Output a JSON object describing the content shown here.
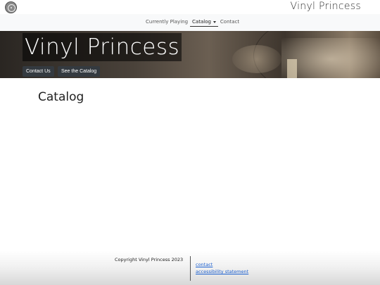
{
  "topbar": {
    "logo_icon": "vinyl-record-icon",
    "brand": "Vinyl Princess"
  },
  "nav": {
    "items": [
      {
        "label": "Currently Playing"
      },
      {
        "label": "Catalog",
        "has_dropdown": true,
        "active": true
      },
      {
        "label": "Contact"
      }
    ]
  },
  "hero": {
    "title": "Vinyl Princess",
    "buttons": [
      {
        "label": "Contact Us"
      },
      {
        "label": "See the Catalog"
      }
    ]
  },
  "main": {
    "title": "Catalog"
  },
  "footer": {
    "copyright": "Copyright Vinyl Princess 2023",
    "links": [
      {
        "label": "contact"
      },
      {
        "label": "accessibility statement"
      }
    ],
    "link_color": "#1a5fd0"
  },
  "colors": {
    "button_bg": "#343a40",
    "nav_bg": "#f8f9fa"
  }
}
